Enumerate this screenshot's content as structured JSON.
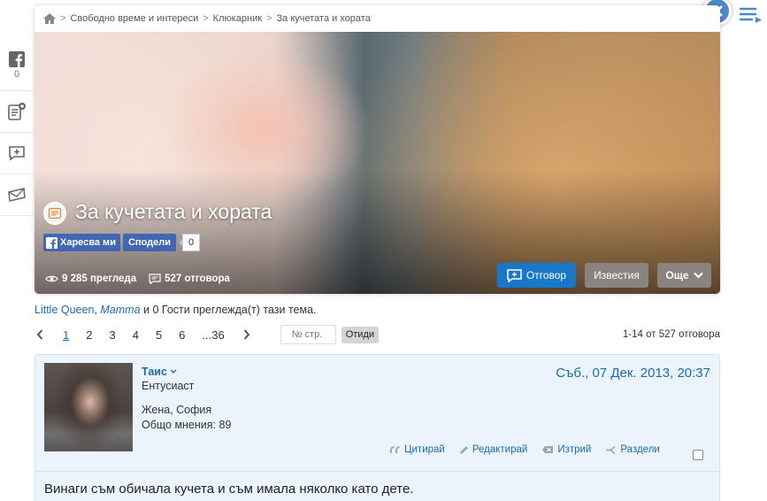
{
  "breadcrumb": {
    "items": [
      "Свободно време и интереси",
      "Клюкарник",
      "За кучетата и хората"
    ]
  },
  "sidebar": {
    "facebook_count": "0"
  },
  "topic": {
    "title": "За кучетата и хората",
    "fb_like_label": "Харесва ми",
    "fb_share_label": "Сподели",
    "fb_count": "0",
    "views": "9 285 прегледа",
    "replies": "527 отговора",
    "reply_button": "Отговор",
    "notify_button": "Известия",
    "more_button": "Още"
  },
  "viewers": {
    "user1": "Little Queen",
    "user2": "Mamma",
    "rest": " и 0 Гости преглежда(т) тази тема."
  },
  "pagination": {
    "pages": [
      "1",
      "2",
      "3",
      "4",
      "5",
      "6",
      "...36"
    ],
    "page_input_placeholder": "№ стр.",
    "go_label": "Отиди",
    "total": "1-14 от 527 отговора"
  },
  "post": {
    "author": "Таис",
    "rank": "Ентусиаст",
    "info": "Жена, София",
    "posts": "Общо мнения: 89",
    "date": "Съб., 07 Дек. 2013, 20:37",
    "actions": {
      "quote": "Цитирай",
      "edit": "Редактирай",
      "delete": "Изтрий",
      "split": "Раздели"
    },
    "text": "Винаги съм обичала кучета и съм имала няколко като дете."
  },
  "colors": {
    "link": "#1c6bb0",
    "reply_button": "#1877c9",
    "facebook": "#4267b2",
    "post_bg": "#ebf4fc"
  }
}
